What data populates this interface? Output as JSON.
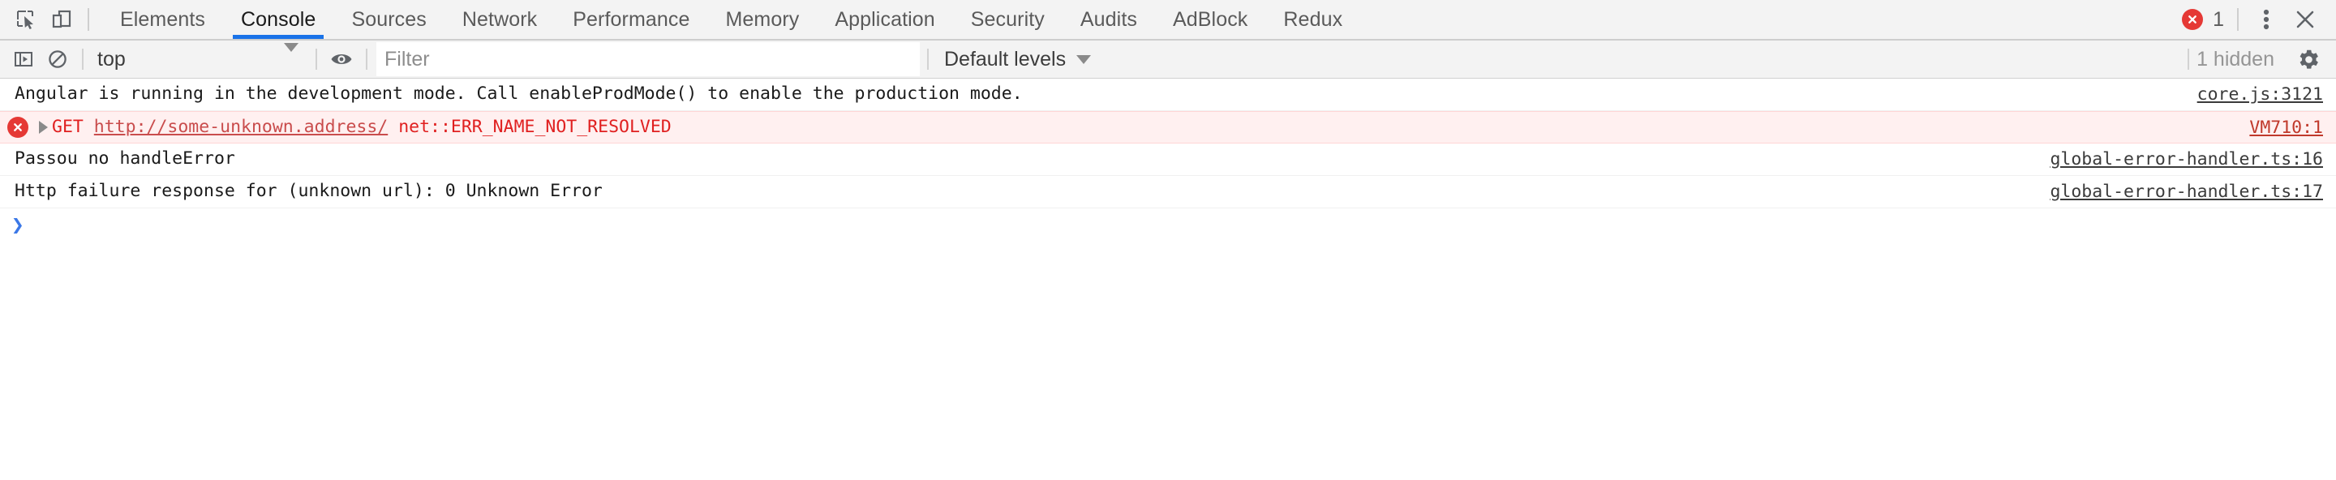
{
  "colors": {
    "accent": "#1a73e8",
    "error_red": "#e02020",
    "error_badge": "#e53935",
    "error_row_bg": "#fff0f0",
    "toolbar_bg": "#f3f3f3",
    "prompt_blue": "#3b78e7"
  },
  "tabbar": {
    "icons": [
      {
        "name": "inspect-element-icon",
        "label": "Inspect element"
      },
      {
        "name": "device-toolbar-icon",
        "label": "Toggle device toolbar"
      }
    ],
    "tabs": [
      {
        "label": "Elements",
        "selected": false
      },
      {
        "label": "Console",
        "selected": true
      },
      {
        "label": "Sources",
        "selected": false
      },
      {
        "label": "Network",
        "selected": false
      },
      {
        "label": "Performance",
        "selected": false
      },
      {
        "label": "Memory",
        "selected": false
      },
      {
        "label": "Application",
        "selected": false
      },
      {
        "label": "Security",
        "selected": false
      },
      {
        "label": "Audits",
        "selected": false
      },
      {
        "label": "AdBlock",
        "selected": false
      },
      {
        "label": "Redux",
        "selected": false
      }
    ],
    "error_count": "1",
    "error_icon": "error-circle-icon",
    "more_icon": "more-vertical-icon",
    "close_icon": "close-icon"
  },
  "consolebar": {
    "sidebar_toggle_icon": "console-sidebar-icon",
    "clear_icon": "clear-console-icon",
    "context": {
      "value": "top",
      "caret_icon": "chevron-down-icon"
    },
    "eye_icon": "live-expression-eye-icon",
    "filter": {
      "value": "",
      "placeholder": "Filter"
    },
    "levels": {
      "value": "Default levels",
      "caret_icon": "chevron-down-icon"
    },
    "hidden_text": "1 hidden",
    "settings_icon": "gear-icon"
  },
  "console_messages": [
    {
      "level": "info",
      "has_icon": false,
      "has_expand": false,
      "text": "Angular is running in the development mode. Call enableProdMode() to enable the production mode.",
      "source": "core.js:3121"
    },
    {
      "level": "error",
      "has_icon": true,
      "has_expand": true,
      "icon": "error-circle-icon",
      "expand_icon": "expand-triangle-icon",
      "method": "GET",
      "url": "http://some-unknown.address/",
      "error_code": "net::ERR_NAME_NOT_RESOLVED",
      "text": "GET http://some-unknown.address/ net::ERR_NAME_NOT_RESOLVED",
      "source": "VM710:1"
    },
    {
      "level": "info",
      "has_icon": false,
      "has_expand": false,
      "text": "Passou no handleError",
      "source": "global-error-handler.ts:16"
    },
    {
      "level": "info",
      "has_icon": false,
      "has_expand": false,
      "text": "Http failure response for (unknown url): 0 Unknown Error",
      "source": "global-error-handler.ts:17"
    }
  ],
  "prompt": {
    "chevron": "›",
    "value": "",
    "placeholder": ""
  }
}
